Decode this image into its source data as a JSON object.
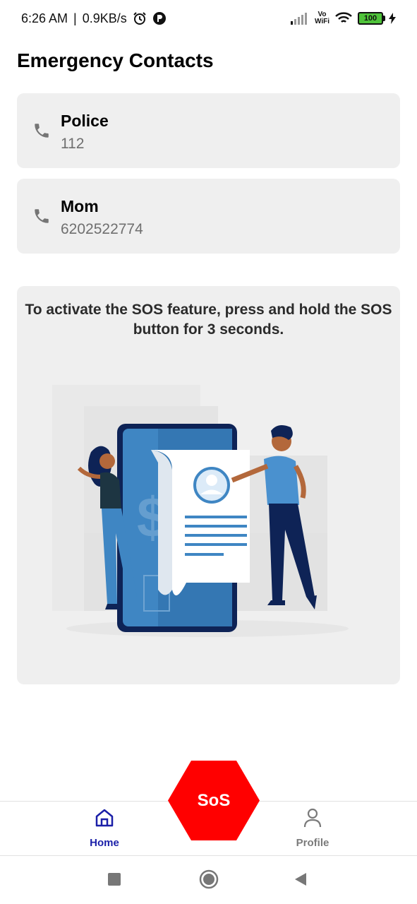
{
  "status_bar": {
    "time": "6:26 AM",
    "separator": "|",
    "net_speed": "0.9KB/s",
    "vowifi_top": "Vo",
    "vowifi_bottom": "WiFi",
    "battery": "100"
  },
  "page": {
    "title": "Emergency Contacts"
  },
  "contacts": [
    {
      "name": "Police",
      "number": "112"
    },
    {
      "name": "Mom",
      "number": "6202522774"
    }
  ],
  "info": {
    "text": "To activate the SOS feature, press and hold the SOS button for 3 seconds."
  },
  "bottom_nav": {
    "home_label": "Home",
    "profile_label": "Profile",
    "sos_label": "SoS"
  },
  "colors": {
    "accent": "#1a1fa8",
    "sos": "#ff0000",
    "card_bg": "#efefef"
  },
  "icons": [
    "alarm-icon",
    "app-notification-icon",
    "signal-icon",
    "wifi-icon",
    "battery-icon",
    "charging-icon",
    "phone-icon",
    "home-icon",
    "person-icon",
    "square-icon",
    "circle-icon",
    "back-triangle-icon"
  ]
}
